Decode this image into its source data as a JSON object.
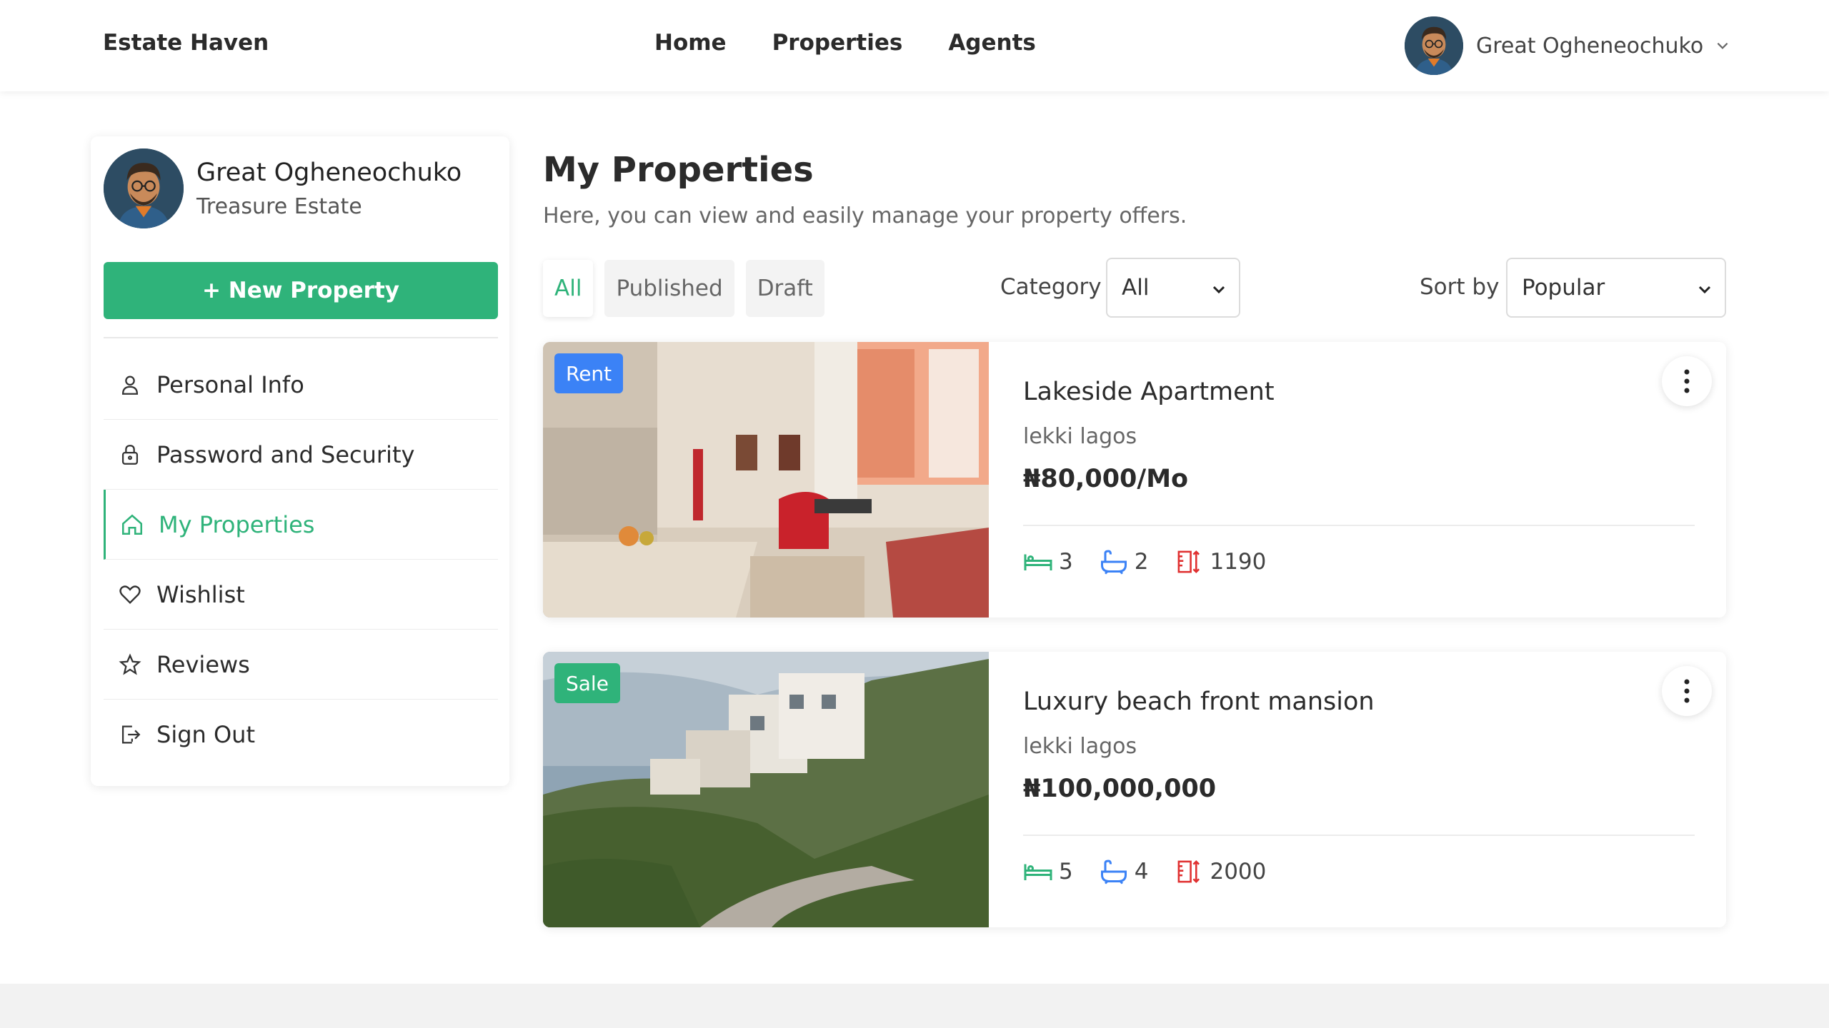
{
  "brand": "Estate Haven",
  "nav": {
    "links": [
      "Home",
      "Properties",
      "Agents"
    ]
  },
  "user": {
    "name": "Great Ogheneochuko",
    "company": "Treasure Estate"
  },
  "sidebar": {
    "new_button": "+ New Property",
    "items": [
      {
        "label": "Personal Info",
        "icon": "person-icon",
        "active": false
      },
      {
        "label": "Password and Security",
        "icon": "lock-icon",
        "active": false
      },
      {
        "label": "My Properties",
        "icon": "home-icon",
        "active": true
      },
      {
        "label": "Wishlist",
        "icon": "heart-icon",
        "active": false
      },
      {
        "label": "Reviews",
        "icon": "star-icon",
        "active": false
      },
      {
        "label": "Sign Out",
        "icon": "sign-out-icon",
        "active": false
      }
    ]
  },
  "main": {
    "title": "My Properties",
    "subtitle": "Here, you can view and easily manage your property offers.",
    "tabs": [
      "All",
      "Published",
      "Draft"
    ],
    "active_tab": "All",
    "category": {
      "label": "Category",
      "value": "All"
    },
    "sort": {
      "label": "Sort by",
      "value": "Popular"
    }
  },
  "properties": [
    {
      "badge": "Rent",
      "badge_color": "#3b82f6",
      "title": "Lakeside Apartment",
      "location": "lekki lagos",
      "price": "₦80,000/Mo",
      "beds": "3",
      "baths": "2",
      "area": "1190"
    },
    {
      "badge": "Sale",
      "badge_color": "#2fb37a",
      "title": "Luxury beach front mansion",
      "location": "lekki lagos",
      "price": "₦100,000,000",
      "beds": "5",
      "baths": "4",
      "area": "2000"
    }
  ],
  "colors": {
    "accent": "#2fb37a",
    "rent_badge": "#3b82f6",
    "sale_badge": "#2fb37a",
    "bed_icon": "#2fb37a",
    "bath_icon": "#3b82f6",
    "area_icon": "#e03131"
  }
}
